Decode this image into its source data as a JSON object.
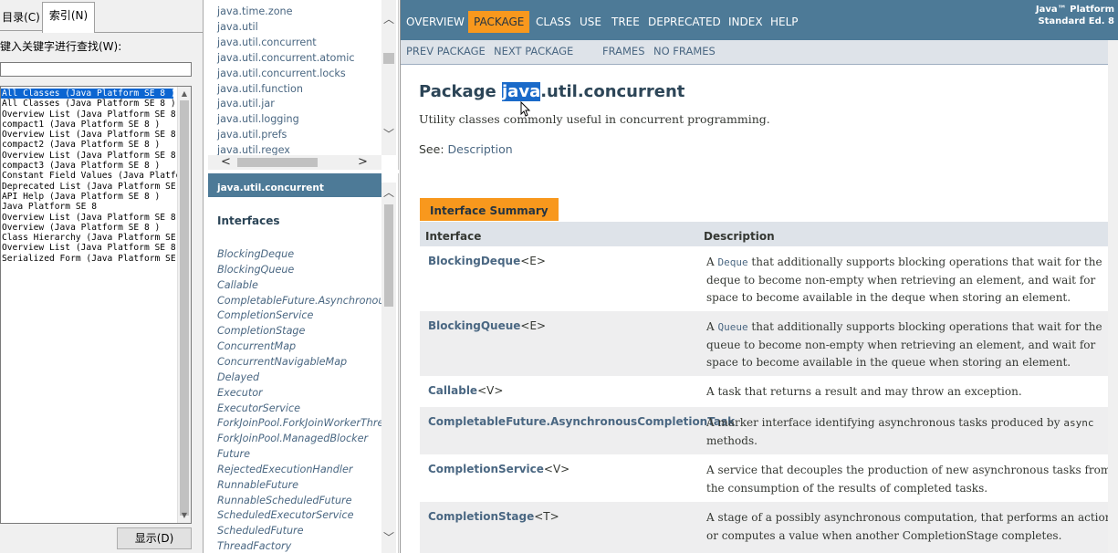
{
  "left": {
    "tab_contents": "目录(C)",
    "tab_index": "索引(N)",
    "keyword_label": "键入关键字进行查找(W):",
    "keyword_value": "",
    "index_items": [
      "All Classes (Java Platform SE 8 )",
      "All Classes (Java Platform SE 8 )",
      "Overview List (Java Platform SE 8",
      "compact1 (Java Platform SE 8 )",
      "Overview List (Java Platform SE 8",
      "compact2 (Java Platform SE 8 )",
      "Overview List (Java Platform SE 8",
      "compact3 (Java Platform SE 8 )",
      "Constant Field Values (Java Platfo",
      "Deprecated List (Java Platform SE",
      "API Help (Java Platform SE 8 )",
      "Java Platform SE 8",
      "Overview List (Java Platform SE 8",
      "Overview (Java Platform SE 8 )",
      "Class Hierarchy (Java Platform SE",
      "Overview List (Java Platform SE 8",
      "Serialized Form (Java Platform SE"
    ],
    "show_button": "显示(D)"
  },
  "packages": [
    "java.time.zone",
    "java.util",
    "java.util.concurrent",
    "java.util.concurrent.atomic",
    "java.util.concurrent.locks",
    "java.util.function",
    "java.util.jar",
    "java.util.logging",
    "java.util.prefs",
    "java.util.regex"
  ],
  "classes": {
    "header": "java.util.concurrent",
    "section": "Interfaces",
    "items": [
      "BlockingDeque",
      "BlockingQueue",
      "Callable",
      "CompletableFuture.AsynchronousCompletionTask",
      "CompletionService",
      "CompletionStage",
      "ConcurrentMap",
      "ConcurrentNavigableMap",
      "Delayed",
      "Executor",
      "ExecutorService",
      "ForkJoinPool.ForkJoinWorkerThreadFactory",
      "ForkJoinPool.ManagedBlocker",
      "Future",
      "RejectedExecutionHandler",
      "RunnableFuture",
      "RunnableScheduledFuture",
      "ScheduledExecutorService",
      "ScheduledFuture",
      "ThreadFactory"
    ]
  },
  "main": {
    "nav": [
      "OVERVIEW",
      "PACKAGE",
      "CLASS",
      "USE",
      "TREE",
      "DEPRECATED",
      "INDEX",
      "HELP"
    ],
    "about_line1": "Java™ Platform",
    "about_line2": "Standard Ed. 8",
    "subnav": [
      "PREV PACKAGE",
      "NEXT PACKAGE",
      "FRAMES",
      "NO FRAMES"
    ],
    "title_prefix": "Package ",
    "title_highlight": "java",
    "title_rest": ".util.concurrent",
    "description": "Utility classes commonly useful in concurrent programming.",
    "see_label": "See: ",
    "see_link": "Description",
    "summary_caption": "Interface Summary",
    "col_interface": "Interface",
    "col_description": "Description",
    "rows": [
      {
        "name": "BlockingDeque",
        "tparam": "<E>",
        "d1": "A ",
        "code": "Deque",
        "d2": " that additionally supports blocking operations that wait for the deque to become non-empty when retrieving an element, and wait for space to become available in the deque when storing an element."
      },
      {
        "name": "BlockingQueue",
        "tparam": "<E>",
        "d1": "A ",
        "code": "Queue",
        "d2": " that additionally supports blocking operations that wait for the queue to become non-empty when retrieving an element, and wait for space to become available in the queue when storing an element."
      },
      {
        "name": "Callable",
        "tparam": "<V>",
        "d1": "A task that returns a result and may throw an exception.",
        "code": "",
        "d2": ""
      },
      {
        "name": "CompletableFuture.AsynchronousCompletionTask",
        "tparam": "",
        "d1": "A marker interface identifying asynchronous tasks produced by ",
        "code": "async",
        "d2": " methods."
      },
      {
        "name": "CompletionService",
        "tparam": "<V>",
        "d1": "A service that decouples the production of new asynchronous tasks from the consumption of the results of completed tasks.",
        "code": "",
        "d2": ""
      },
      {
        "name": "CompletionStage",
        "tparam": "<T>",
        "d1": "A stage of a possibly asynchronous computation, that performs an action or computes a value when another CompletionStage completes.",
        "code": "",
        "d2": ""
      }
    ]
  },
  "colors": {
    "nav_bg": "#4d7a97",
    "accent": "#f8981d",
    "link": "#4a6782",
    "subnav_bg": "#dee3e9",
    "selection": "#0b65d1"
  }
}
